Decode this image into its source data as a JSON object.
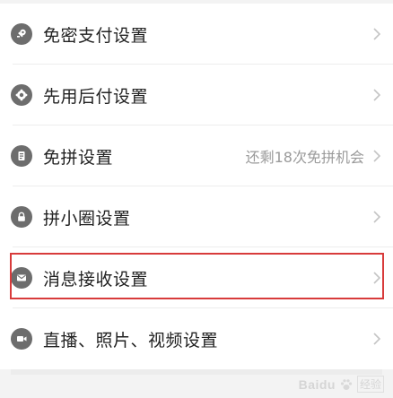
{
  "settings_items": [
    {
      "label": "免密支付设置",
      "hint": "",
      "icon": "key-icon"
    },
    {
      "label": "先用后付设置",
      "hint": "",
      "icon": "badge-icon"
    },
    {
      "label": "免拼设置",
      "hint": "还剩18次免拼机会",
      "icon": "document-icon"
    },
    {
      "label": "拼小圈设置",
      "hint": "",
      "icon": "lock-icon"
    },
    {
      "label": "消息接收设置",
      "hint": "",
      "icon": "mail-icon"
    },
    {
      "label": "直播、照片、视频设置",
      "hint": "",
      "icon": "video-camera-icon"
    }
  ],
  "watermark": {
    "brand": "Baidu",
    "suffix": "经验"
  },
  "colors": {
    "highlight": "#d83b3b",
    "icon_bg": "#6d6d6d",
    "hint_text": "#9a9a9a"
  }
}
